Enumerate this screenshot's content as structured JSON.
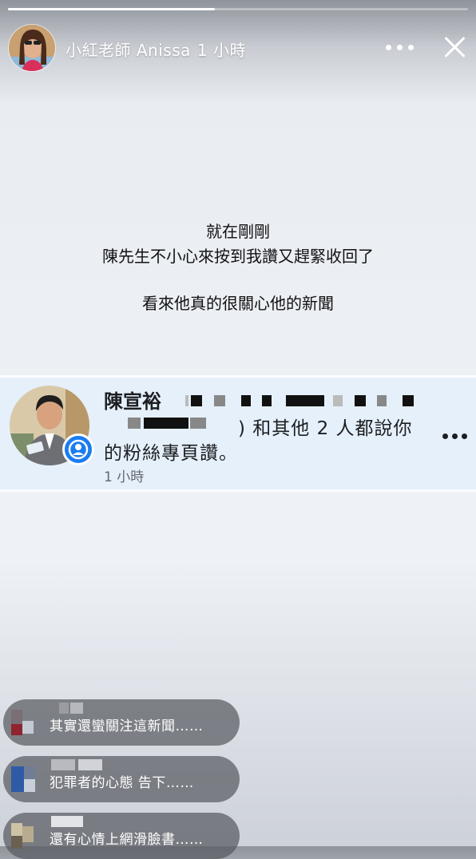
{
  "story": {
    "progress": 0.45,
    "user": {
      "name": "小紅老師 Anissa",
      "time": "1 小時"
    }
  },
  "caption": {
    "line1": "就在剛剛",
    "line2": "陳先生不小心來按到我讚又趕緊收回了",
    "line3": "看來他真的很關心他的新聞"
  },
  "notification": {
    "name": "陳宣裕",
    "line2": ") 和其他 2 人都說你",
    "line3": "的粉絲專頁讚。",
    "time": "1 小時"
  },
  "comments": [
    {
      "text": "其實還蠻關注這新聞……"
    },
    {
      "text": "犯罪者的心態  告下……"
    },
    {
      "text": "還有心情上網滑臉書……"
    }
  ]
}
